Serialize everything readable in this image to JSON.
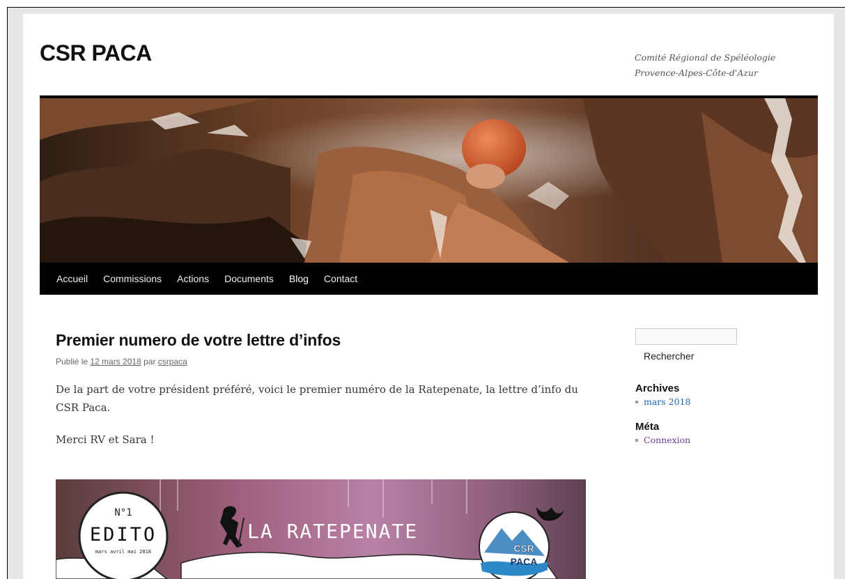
{
  "site": {
    "title": "CSR PACA",
    "description_line1": "Comité Régional de Spéléologie",
    "description_line2": "Provence-Alpes-Côte-d'Azur"
  },
  "nav": {
    "items": [
      {
        "label": "Accueil"
      },
      {
        "label": "Commissions"
      },
      {
        "label": "Actions"
      },
      {
        "label": "Documents"
      },
      {
        "label": "Blog"
      },
      {
        "label": "Contact"
      }
    ],
    "current": "Blog"
  },
  "post": {
    "title": "Premier numero de votre lettre d’infos",
    "meta_prefix": "Publié le ",
    "date": "12 mars 2018",
    "meta_by": " par ",
    "author": "csrpaca",
    "paragraph1": "De la part de votre président préféré, voici le premier numéro de la Ratepenate, la lettre d’info du CSR Paca.",
    "paragraph2": "Merci RV et Sara !"
  },
  "newsletter_image": {
    "issue": "N°1",
    "edito": "EDITO",
    "period": "mars avril mai 2018",
    "name": "LA RATEPENATE",
    "logo_line1": "CSR",
    "logo_line2": "PACA"
  },
  "sidebar": {
    "search_button": "Rechercher",
    "archives_title": "Archives",
    "archives": [
      {
        "label": "mars 2018"
      }
    ],
    "meta_title": "Méta",
    "meta": [
      {
        "label": "Connexion"
      }
    ]
  },
  "colors": {
    "nav_bg": "#000000",
    "archive_link": "#1b6ab8",
    "meta_link": "#6c3a99"
  }
}
